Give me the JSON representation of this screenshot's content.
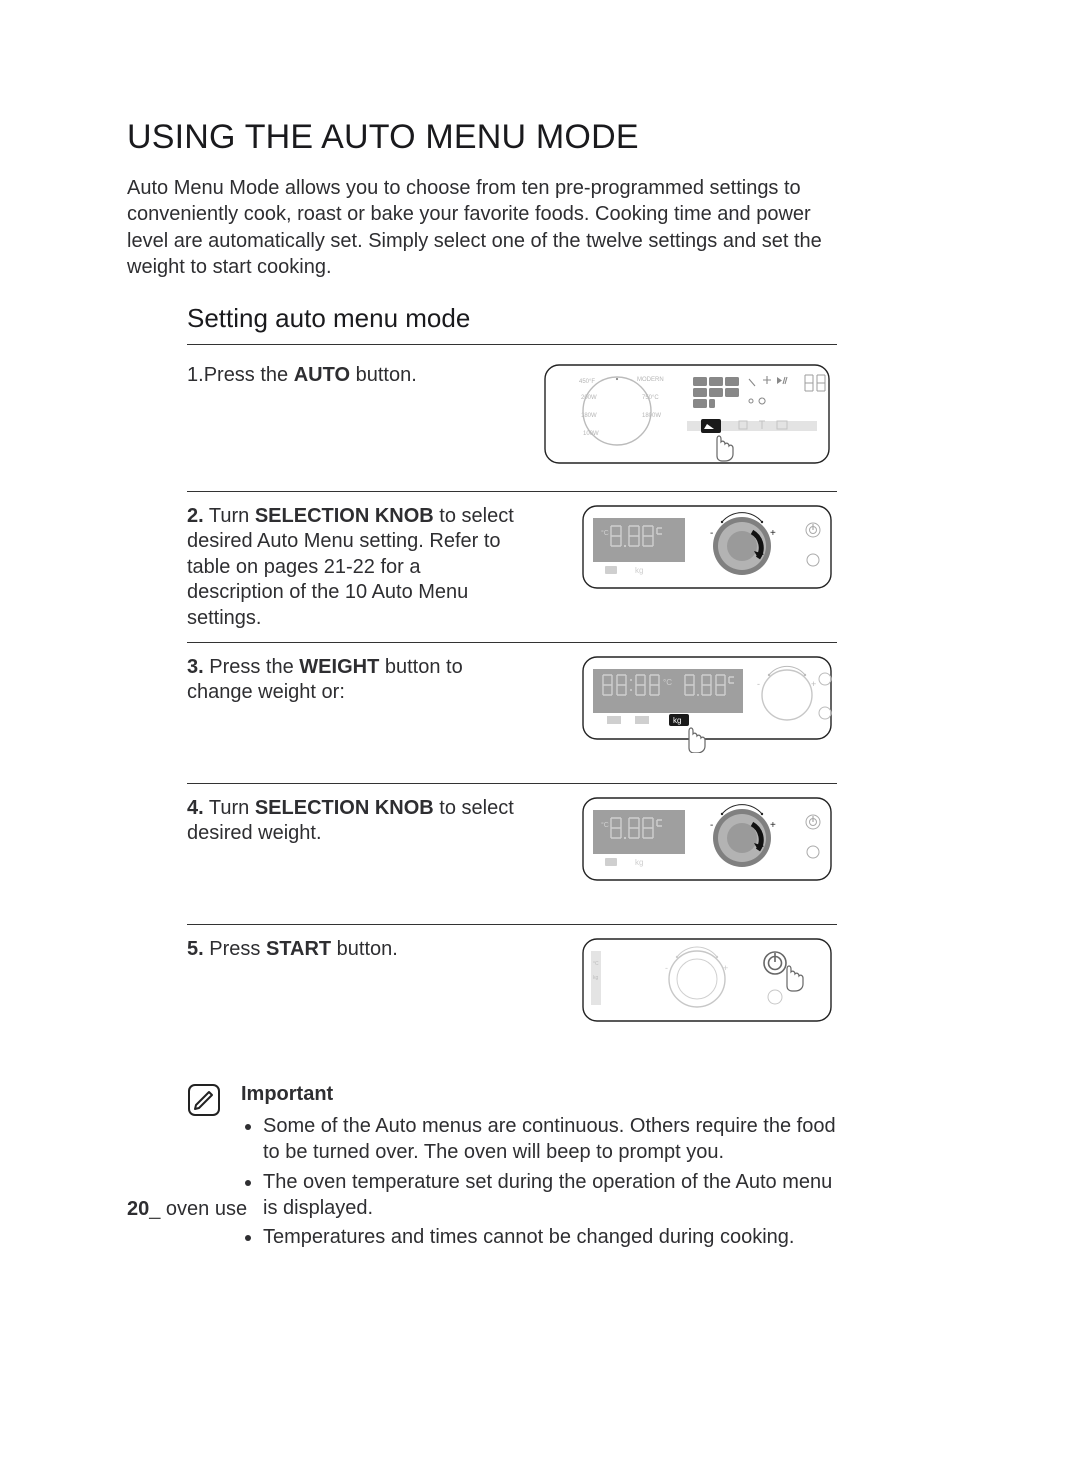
{
  "title": "USING THE AUTO MENU MODE",
  "intro": "Auto Menu Mode allows you to choose from ten pre-programmed settings to conveniently cook, roast or bake your favorite foods. Cooking time and power level are automatically set. Simply select one of the twelve settings and set the weight to start cooking.",
  "subsection": "Setting auto menu mode",
  "steps": [
    {
      "num": "1.",
      "pre": "Press the ",
      "bold": "AUTO",
      "post": " button."
    },
    {
      "num": "2.",
      "pre": " Turn ",
      "bold": "SELECTION KNOB",
      "post": " to select desired Auto Menu setting. Refer to table on pages 21-22 for a description of the 10 Auto Menu settings."
    },
    {
      "num": "3.",
      "pre": " Press the ",
      "bold": "WEIGHT",
      "post": " button to change weight or:"
    },
    {
      "num": "4.",
      "pre": " Turn ",
      "bold": "SELECTION KNOB",
      "post": " to select desired weight."
    },
    {
      "num": "5.",
      "pre": " Press ",
      "bold": "START",
      "post": " button."
    }
  ],
  "note": {
    "title": "Important",
    "items": [
      "Some of the Auto menus are continuous. Others require the food to be turned over. The oven will beep to prompt you.",
      "The oven temperature set during the operation of the Auto menu is displayed.",
      "Temperatures and times cannot be changed during cooking."
    ]
  },
  "footer": {
    "pagenum": "20",
    "sep": "_",
    "section": " oven use"
  }
}
